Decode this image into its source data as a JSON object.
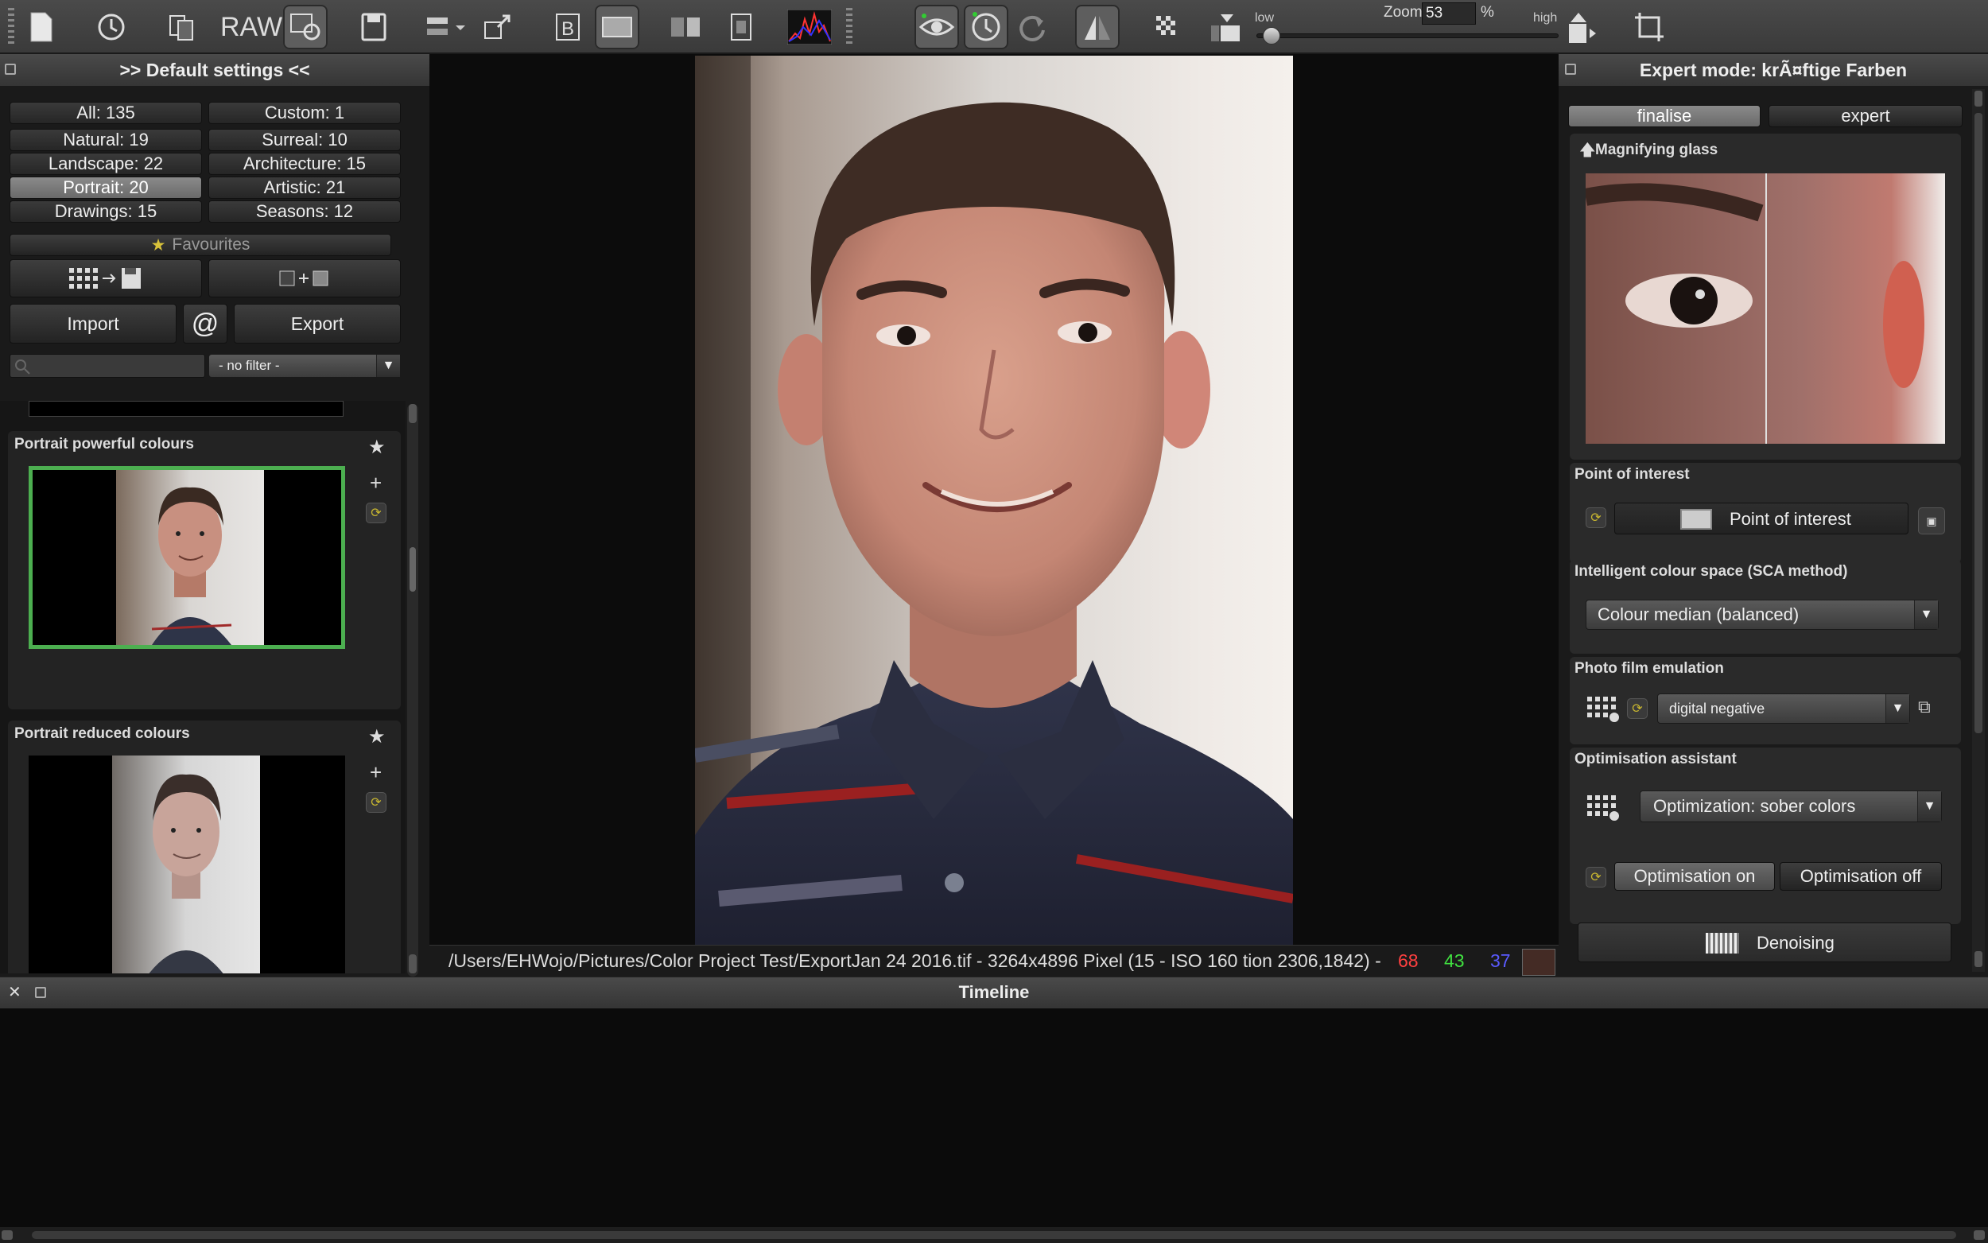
{
  "toolbar": {
    "raw_label": "RAW",
    "zoom_label": "Zoom",
    "zoom_value": "53",
    "zoom_unit": "%",
    "slider_low": "low",
    "slider_high": "high",
    "slider_level": 0.02
  },
  "left_panel": {
    "title": ">> Default settings <<",
    "categories": [
      {
        "label": "All: 135",
        "selected": false
      },
      {
        "label": "Custom: 1",
        "selected": false
      },
      {
        "label": "Natural: 19",
        "selected": false
      },
      {
        "label": "Surreal: 10",
        "selected": false
      },
      {
        "label": "Landscape: 22",
        "selected": false
      },
      {
        "label": "Architecture: 15",
        "selected": false
      },
      {
        "label": "Portrait: 20",
        "selected": true
      },
      {
        "label": "Artistic: 21",
        "selected": false
      },
      {
        "label": "Drawings: 15",
        "selected": false
      },
      {
        "label": "Seasons: 12",
        "selected": false
      }
    ],
    "favourites_label": "Favourites",
    "import_label": "Import",
    "at_label": "@",
    "export_label": "Export",
    "search_placeholder": "",
    "filter_value": "- no filter -",
    "presets": [
      {
        "title": "Portrait powerful colours",
        "selected": true
      },
      {
        "title": "Portrait reduced colours",
        "selected": false
      }
    ]
  },
  "status_bar": {
    "path": "/Users/EHWojo/Pictures/Color Project Test/ExportJan 24 2016.tif - 3264x4896 Pixel (15  - ISO 160  tion  2306,1842) -",
    "r": "68",
    "g": "43",
    "b": "37",
    "swatch_color": "#442b25"
  },
  "right_panel": {
    "title": "Expert mode: krÃ¤ftige Farben",
    "tab_finalise": "finalise",
    "tab_expert": "expert",
    "magnifier_label": "Magnifying glass",
    "poi_section": "Point of interest",
    "poi_button": "Point of interest",
    "sca_section": "Intelligent colour space (SCA method)",
    "sca_value": "Colour median (balanced)",
    "film_section": "Photo film emulation",
    "film_value": "digital negative",
    "opt_section": "Optimisation assistant",
    "opt_value": "Optimization: sober colors",
    "opt_on": "Optimisation on",
    "opt_off": "Optimisation off",
    "denoising_label": "Denoising"
  },
  "timeline": {
    "title": "Timeline"
  },
  "colors": {
    "selected_green": "#4caf50",
    "r_text": "#ff4040",
    "g_text": "#40e040",
    "b_text": "#5a5aff"
  }
}
